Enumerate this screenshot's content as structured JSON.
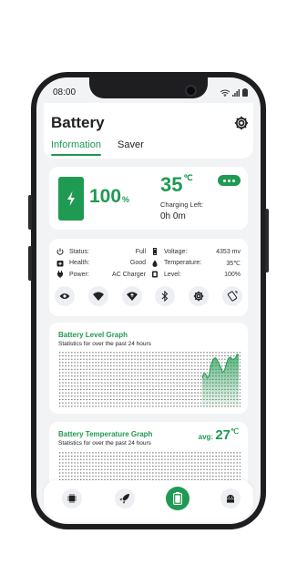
{
  "status_bar": {
    "time": "08:00"
  },
  "header": {
    "title": "Battery",
    "tabs": [
      "Information",
      "Saver"
    ]
  },
  "battery_card": {
    "percent_value": "100",
    "percent_unit": "%",
    "temperature_value": "35",
    "temperature_unit": "℃",
    "charging_left_label": "Charging Left:",
    "charging_left_value": "0h 0m"
  },
  "info": {
    "status_label": "Status:",
    "status_value": "Full",
    "health_label": "Health:",
    "health_value": "Good",
    "power_label": "Power:",
    "power_value": "AC Charger",
    "voltage_label": "Voltage:",
    "voltage_value": "4353 mv",
    "temperature_label": "Temperature:",
    "temperature_value": "35℃",
    "level_label": "Level:",
    "level_value": "100%"
  },
  "level_graph": {
    "title": "Battery Level Graph",
    "subtitle": "Statistics for over the past 24 hours"
  },
  "temp_graph": {
    "title": "Battery Temperature Graph",
    "subtitle": "Statistics for over the past 24 hours",
    "avg_label": "avg:",
    "avg_value": "27",
    "avg_unit": "℃"
  },
  "colors": {
    "accent": "#1f9a52",
    "background": "#f2f3f5",
    "card": "#ffffff",
    "frame": "#1e1e20"
  }
}
